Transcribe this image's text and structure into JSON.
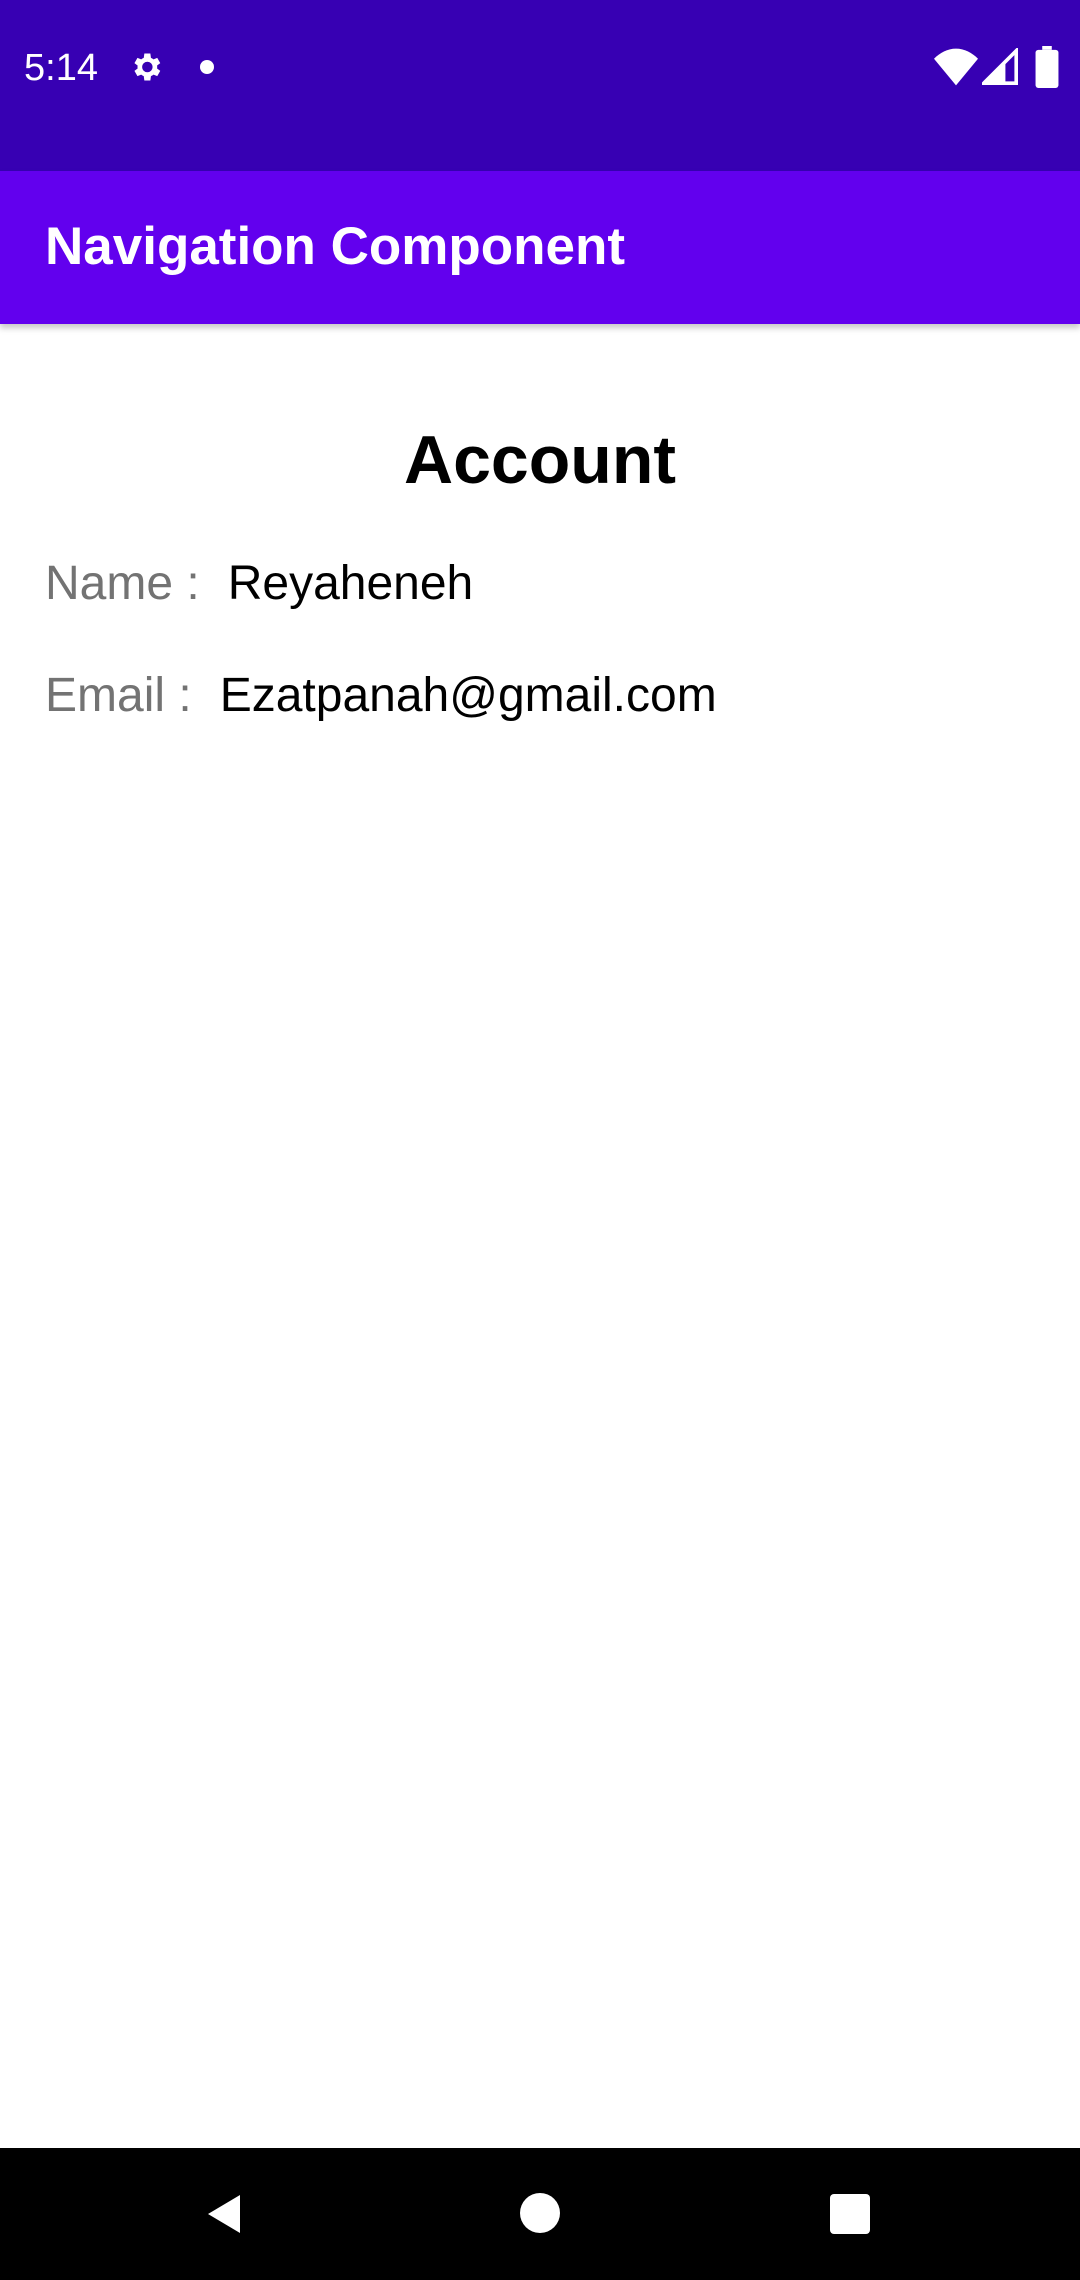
{
  "status_bar": {
    "time": "5:14",
    "icons": [
      "gear-icon",
      "notification-dot-icon",
      "wifi-icon",
      "cell-signal-icon",
      "battery-icon"
    ],
    "background_color": "#3700B3"
  },
  "app_bar": {
    "title": "Navigation Component",
    "background_color": "#6200EE"
  },
  "account": {
    "title": "Account",
    "name_label": "Name :",
    "name_value": "Reyaheneh",
    "email_label": "Email :",
    "email_value": "Ezatpanah@gmail.com"
  },
  "nav_bar": {
    "buttons": [
      "back-icon",
      "home-icon",
      "recents-icon"
    ]
  }
}
